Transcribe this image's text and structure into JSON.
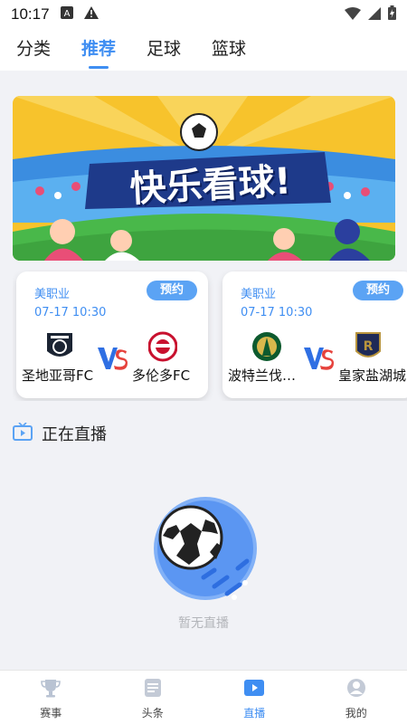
{
  "status_bar": {
    "time": "10:17"
  },
  "tabs": [
    {
      "label": "分类",
      "active": false
    },
    {
      "label": "推荐",
      "active": true
    },
    {
      "label": "足球",
      "active": false
    },
    {
      "label": "篮球",
      "active": false
    }
  ],
  "banner": {
    "text": "快乐看球!"
  },
  "matches": [
    {
      "league": "美职业",
      "time": "07-17 10:30",
      "button": "预约",
      "home": "圣地亚哥FC",
      "away": "多伦多FC"
    },
    {
      "league": "美职业",
      "time": "07-17 10:30",
      "button": "预约",
      "home": "波特兰伐…",
      "away": "皇家盐湖城"
    }
  ],
  "live_section": {
    "title": "正在直播",
    "empty_text": "暂无直播"
  },
  "bottom_nav": [
    {
      "label": "赛事",
      "icon": "trophy-icon",
      "active": false
    },
    {
      "label": "头条",
      "icon": "news-icon",
      "active": false
    },
    {
      "label": "直播",
      "icon": "play-icon",
      "active": true
    },
    {
      "label": "我的",
      "icon": "profile-icon",
      "active": false
    }
  ],
  "colors": {
    "accent": "#3f8ef2",
    "vs_blue": "#2f6fe3",
    "vs_red": "#e6423c",
    "background": "#f1f2f6"
  }
}
